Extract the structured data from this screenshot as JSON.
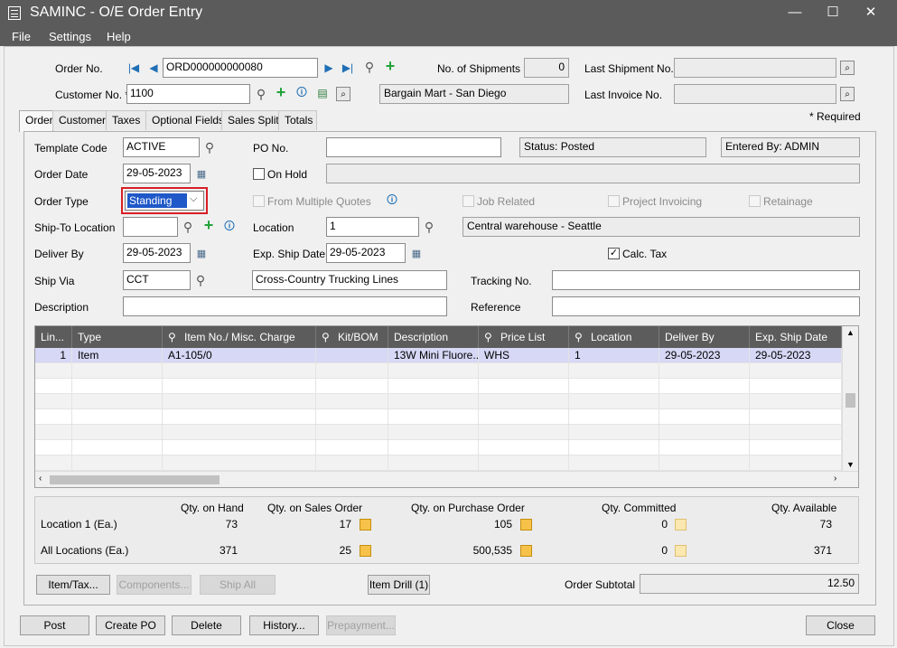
{
  "window": {
    "title": "SAMINC - O/E Order Entry",
    "controls": {
      "minimize": "—",
      "maximize": "☐",
      "close": "✕"
    }
  },
  "menu": [
    "File",
    "Settings",
    "Help"
  ],
  "header": {
    "order_no_label": "Order No.",
    "order_no": "ORD000000000080",
    "shipments_label": "No. of Shipments",
    "shipments": "0",
    "last_shipment_label": "Last Shipment No.",
    "last_shipment": "",
    "customer_no_label": "Customer No. *",
    "customer_no": "1100",
    "customer_name": "Bargain Mart - San Diego",
    "last_invoice_label": "Last Invoice No.",
    "last_invoice": "",
    "required_note": "* Required"
  },
  "tabs": [
    "Order",
    "Customer",
    "Taxes",
    "Optional Fields",
    "Sales Split",
    "Totals"
  ],
  "order": {
    "template_code_label": "Template Code",
    "template_code": "ACTIVE",
    "po_no_label": "PO No.",
    "po_no": "",
    "status": "Status: Posted",
    "entered_by": "Entered By: ADMIN",
    "order_date_label": "Order Date",
    "order_date": "29-05-2023",
    "on_hold_label": "On Hold",
    "on_hold_reason": "",
    "order_type_label": "Order Type",
    "order_type": "Standing",
    "from_multiple_quotes_label": "From Multiple Quotes",
    "job_related_label": "Job Related",
    "project_invoicing_label": "Project Invoicing",
    "retainage_label": "Retainage",
    "ship_to_label": "Ship-To Location",
    "ship_to": "",
    "location_label": "Location",
    "location": "1",
    "location_desc": "Central warehouse - Seattle",
    "deliver_by_label": "Deliver By",
    "deliver_by": "29-05-2023",
    "exp_ship_label": "Exp. Ship Date",
    "exp_ship": "29-05-2023",
    "calc_tax_label": "Calc. Tax",
    "ship_via_label": "Ship Via",
    "ship_via": "CCT",
    "ship_via_desc": "Cross-Country Trucking Lines",
    "tracking_label": "Tracking No.",
    "tracking": "",
    "description_label": "Description",
    "description": "",
    "reference_label": "Reference",
    "reference": ""
  },
  "grid": {
    "columns": [
      "Lin...",
      "Type",
      "Item No./ Misc. Charge",
      "Kit/BOM",
      "Description",
      "Price List",
      "Location",
      "Deliver By",
      "Exp. Ship Date"
    ],
    "rows": [
      [
        "1",
        "Item",
        "A1-105/0",
        "",
        "13W Mini Fluore...",
        "WHS",
        "1",
        "29-05-2023",
        "29-05-2023"
      ]
    ]
  },
  "stock": {
    "headers": [
      "Qty. on Hand",
      "Qty. on Sales Order",
      "Qty. on Purchase Order",
      "Qty. Committed",
      "Qty. Available"
    ],
    "location_label": "Location  1 (Ea.)",
    "location_values": [
      "73",
      "17",
      "105",
      "0",
      "73"
    ],
    "all_label": "All Locations (Ea.)",
    "all_values": [
      "371",
      "25",
      "500,535",
      "0",
      "371"
    ]
  },
  "buttons": {
    "item_tax": "Item/Tax...",
    "components": "Components...",
    "ship_all": "Ship All",
    "item_drill": "Item Drill (1)",
    "subtotal_label": "Order Subtotal",
    "subtotal": "12.50",
    "post": "Post",
    "create_po": "Create PO",
    "delete": "Delete",
    "history": "History...",
    "prepayment": "Prepayment...",
    "close": "Close"
  },
  "colors": {
    "titlebar": "#5b5b5b",
    "selected_row": "#d6d8f5",
    "selected_combo": "#1f58c8",
    "highlight_border": "#d81f26"
  }
}
